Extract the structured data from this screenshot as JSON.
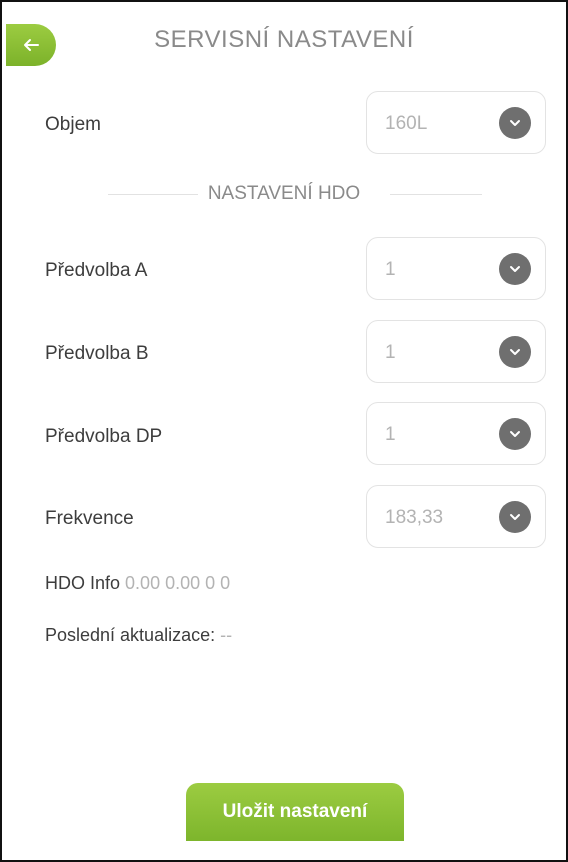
{
  "header": {
    "title": "SERVISNÍ NASTAVENÍ",
    "back_icon": "arrow-left-icon"
  },
  "volume": {
    "label": "Objem",
    "value": "160L"
  },
  "hdo_section": {
    "title": "NASTAVENÍ HDO"
  },
  "rows": [
    {
      "label": "Předvolba A",
      "value": "1"
    },
    {
      "label": "Předvolba B",
      "value": "1"
    },
    {
      "label": "Předvolba DP",
      "value": "1"
    },
    {
      "label": "Frekvence",
      "value": "183,33"
    }
  ],
  "hdo_info": {
    "label": "HDO Info",
    "value": "0.00 0.00 0 0"
  },
  "last_update": {
    "label": "Poslední aktualizace:",
    "value": "--"
  },
  "save_button": {
    "label": "Uložit nastavení"
  },
  "colors": {
    "accent_green": "#8cc23a",
    "chevron_gray": "#6f6f6f"
  }
}
